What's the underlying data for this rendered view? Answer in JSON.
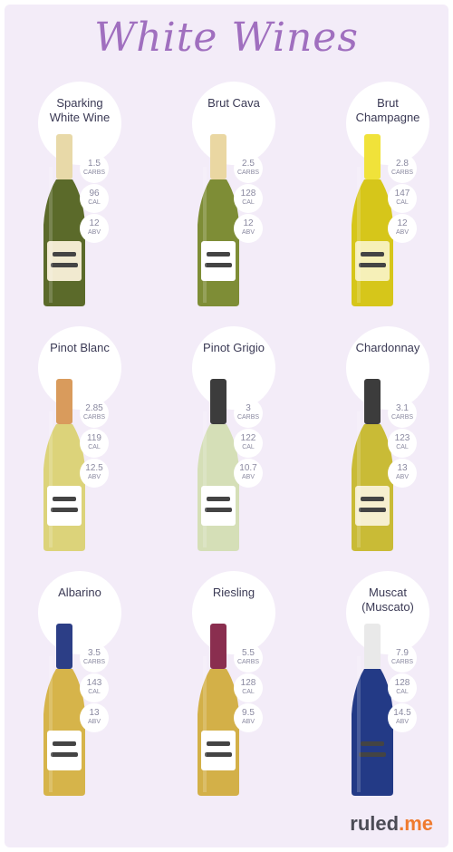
{
  "title": "White Wines",
  "brand": {
    "name": "ruled",
    "dot_suffix": ".me"
  },
  "units": {
    "carbs": "CARBS",
    "cal": "CAL",
    "abv": "ABV"
  },
  "wines": [
    {
      "name": "Sparking\nWhite Wine",
      "carbs": "1.5",
      "cal": "96",
      "abv": "12",
      "glass": "#5b6a2a",
      "neck": "#e8d9a8",
      "label": "#f1ead0"
    },
    {
      "name": "Brut Cava",
      "carbs": "2.5",
      "cal": "128",
      "abv": "12",
      "glass": "#7e8d36",
      "neck": "#ead7a2",
      "label": "#ffffff"
    },
    {
      "name": "Brut\nChampagne",
      "carbs": "2.8",
      "cal": "147",
      "abv": "12",
      "glass": "#d6c61a",
      "neck": "#f0e23a",
      "label": "#f6f0b8"
    },
    {
      "name": "Pinot Blanc",
      "carbs": "2.85",
      "cal": "119",
      "abv": "12.5",
      "glass": "#dcd37a",
      "neck": "#d99b5c",
      "label": "#ffffff"
    },
    {
      "name": "Pinot Grigio",
      "carbs": "3",
      "cal": "122",
      "abv": "10.7",
      "glass": "#d5dfb7",
      "neck": "#3c3c3c",
      "label": "#ffffff"
    },
    {
      "name": "Chardonnay",
      "carbs": "3.1",
      "cal": "123",
      "abv": "13",
      "glass": "#c9bb36",
      "neck": "#3c3c3c",
      "label": "#f6efcf"
    },
    {
      "name": "Albarino",
      "carbs": "3.5",
      "cal": "143",
      "abv": "13",
      "glass": "#d6b44a",
      "neck": "#2c3e86",
      "label": "#ffffff"
    },
    {
      "name": "Riesling",
      "carbs": "5.5",
      "cal": "128",
      "abv": "9.5",
      "glass": "#d3b048",
      "neck": "#8a2e4f",
      "label": "#ffffff"
    },
    {
      "name": "Muscat\n(Muscato)",
      "carbs": "7.9",
      "cal": "128",
      "abv": "14.5",
      "glass": "#233a86",
      "neck": "#e9e9e9",
      "label": "#233a86"
    }
  ]
}
